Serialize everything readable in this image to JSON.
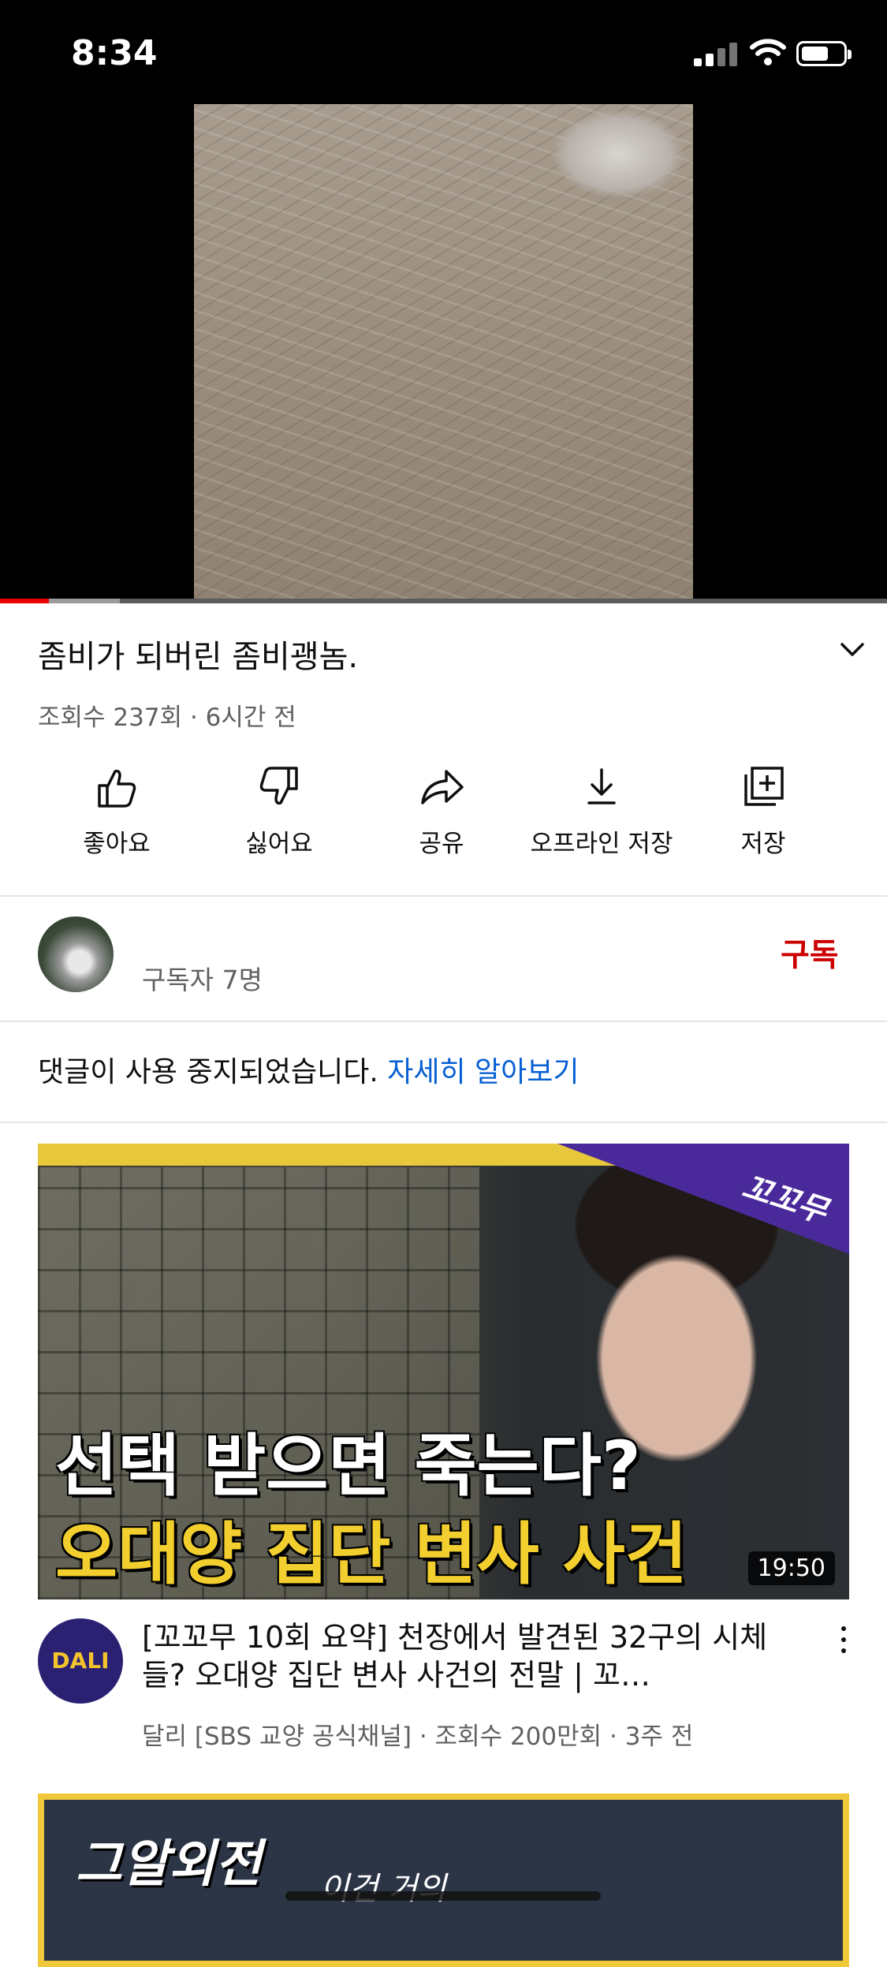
{
  "status_bar": {
    "time": "8:34",
    "icons": [
      "cellular-signal-icon",
      "wifi-icon",
      "battery-icon"
    ],
    "battery_level": 0.7
  },
  "player": {
    "progress_played": 0.055,
    "progress_buffered": 0.135,
    "colors": {
      "played": "#ee0000",
      "buffered": "#9c9c9c",
      "track": "#5b5b5b"
    }
  },
  "video": {
    "title": "좀비가 되버린 좀비괭놈.",
    "meta": "조회수 237회 · 6시간 전"
  },
  "actions": [
    {
      "label": "좋아요",
      "icon": "thumbs-up-icon"
    },
    {
      "label": "싫어요",
      "icon": "thumbs-down-icon"
    },
    {
      "label": "공유",
      "icon": "share-icon"
    },
    {
      "label": "오프라인 저장",
      "icon": "download-icon"
    },
    {
      "label": "저장",
      "icon": "add-to-playlist-icon"
    }
  ],
  "channel": {
    "subscribers": "구독자 7명",
    "subscribe_label": "구독",
    "subscribe_color": "#cc0000"
  },
  "comments": {
    "disabled_text": "댓글이 사용 중지되었습니다.",
    "learn_more": "자세히 알아보기",
    "link_color": "#065fd4"
  },
  "recommendations": [
    {
      "thumbnail": {
        "corner_text": "꼬꼬무",
        "line1": "선택 받으면 죽는다?",
        "line2": "오대양 집단 변사 사건",
        "duration": "19:50"
      },
      "channel_avatar_text": "DALI",
      "title": "[꼬꼬무 10회 요약] 천장에서 발견된 32구의 시체들? 오대양 집단 변사 사건의 전말 | 꼬…",
      "meta": "달리 [SBS 교양 공식채널] · 조회수 200만회 · 3주 전"
    },
    {
      "thumbnail": {
        "logo_text": "그알외전",
        "sub_text": "이건 거의"
      }
    }
  ]
}
